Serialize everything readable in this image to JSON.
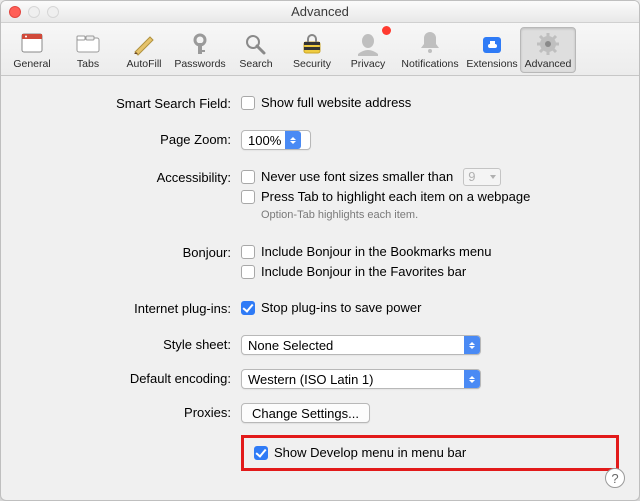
{
  "window": {
    "title": "Advanced"
  },
  "toolbar": {
    "items": [
      {
        "label": "General"
      },
      {
        "label": "Tabs"
      },
      {
        "label": "AutoFill"
      },
      {
        "label": "Passwords"
      },
      {
        "label": "Search"
      },
      {
        "label": "Security"
      },
      {
        "label": "Privacy"
      },
      {
        "label": "Notifications"
      },
      {
        "label": "Extensions"
      },
      {
        "label": "Advanced"
      }
    ]
  },
  "sections": {
    "smart_search": {
      "label": "Smart Search Field:",
      "show_full_url": "Show full website address"
    },
    "page_zoom": {
      "label": "Page Zoom:",
      "value": "100%"
    },
    "accessibility": {
      "label": "Accessibility:",
      "never_smaller": "Never use font sizes smaller than",
      "font_size": "9",
      "press_tab": "Press Tab to highlight each item on a webpage",
      "hint": "Option-Tab highlights each item."
    },
    "bonjour": {
      "label": "Bonjour:",
      "bookmarks": "Include Bonjour in the Bookmarks menu",
      "favorites": "Include Bonjour in the Favorites bar"
    },
    "plugins": {
      "label": "Internet plug-ins:",
      "stop": "Stop plug-ins to save power"
    },
    "stylesheet": {
      "label": "Style sheet:",
      "value": "None Selected"
    },
    "encoding": {
      "label": "Default encoding:",
      "value": "Western (ISO Latin 1)"
    },
    "proxies": {
      "label": "Proxies:",
      "button": "Change Settings..."
    },
    "develop": {
      "label": "Show Develop menu in menu bar"
    }
  },
  "help": "?"
}
